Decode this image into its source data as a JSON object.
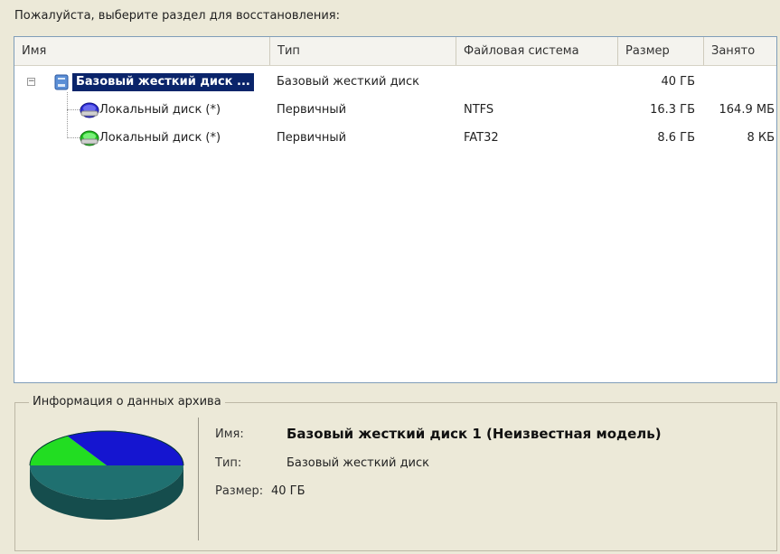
{
  "prompt": "Пожалуйста, выберите раздел для восстановления:",
  "columns": [
    "Имя",
    "Тип",
    "Файловая система",
    "Размер",
    "Занято"
  ],
  "rows": [
    {
      "name": "Базовый жесткий диск ...",
      "type": "Базовый жесткий диск",
      "fs": "",
      "size": "40 ГБ",
      "used": ""
    },
    {
      "name": "Локальный диск (*)",
      "type": "Первичный",
      "fs": "NTFS",
      "size": "16.3 ГБ",
      "used": "164.9 МБ"
    },
    {
      "name": "Локальный диск (*)",
      "type": "Первичный",
      "fs": "FAT32",
      "size": "8.6 ГБ",
      "used": "8 КБ"
    }
  ],
  "info": {
    "legend": "Информация о данных архива",
    "name_label": "Имя:",
    "name_value": "Базовый жесткий диск 1 (Неизвестная модель)",
    "type_label": "Тип:",
    "type_value": "Базовый жесткий диск",
    "size_label": "Размер:",
    "size_value": "40 ГБ"
  },
  "colors": {
    "selection": "#0a246a",
    "pie_blue": "#1515d0",
    "pie_green": "#22dd22",
    "pie_teal": "#1f7070"
  },
  "icons": [
    "collapse-toggle-icon",
    "hard-disk-icon",
    "partition-icon"
  ]
}
